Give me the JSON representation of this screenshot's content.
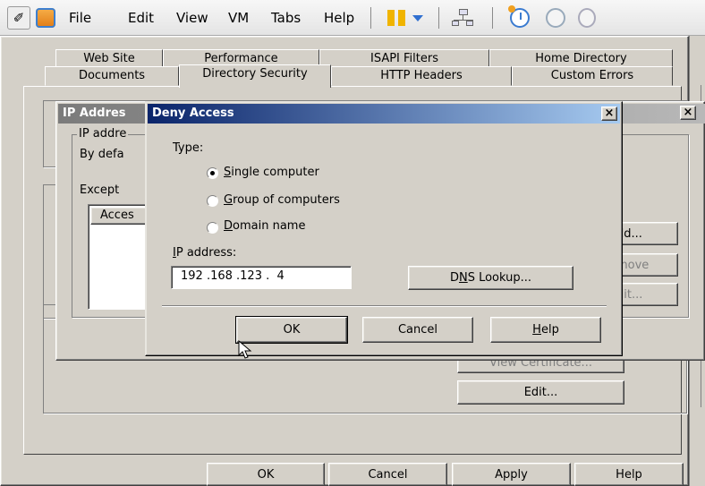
{
  "vm_toolbar": {
    "menus": [
      "File",
      "Edit",
      "View",
      "VM",
      "Tabs",
      "Help"
    ]
  },
  "properties": {
    "tabs_row1": [
      "Web Site",
      "Performance",
      "ISAPI Filters",
      "Home Directory"
    ],
    "tabs_row2": [
      "Documents",
      "Directory Security",
      "HTTP Headers",
      "Custom Errors"
    ],
    "view_certificate": "View Certificate...",
    "edit": "Edit...",
    "ok": "OK",
    "cancel": "Cancel",
    "apply": "Apply",
    "help": "Help"
  },
  "ip_restrictions": {
    "title": "IP Addres",
    "group_label": "IP addre",
    "by_default": "By defa",
    "except": "Except",
    "column": "Acces",
    "add": "dd...",
    "remove": "move",
    "edit": "dit..."
  },
  "deny_dialog": {
    "title": "Deny Access",
    "type_label": "Type:",
    "options": {
      "single": {
        "underline": "S",
        "rest": "ingle computer"
      },
      "group": {
        "underline": "G",
        "rest": "roup of computers"
      },
      "domain": {
        "underline": "D",
        "rest": "omain name"
      }
    },
    "ip_label": {
      "underline": "I",
      "rest": "P address:"
    },
    "ip_value": "192 .168 .123 .  4",
    "dns": {
      "pre": "D",
      "underline": "N",
      "rest": "S Lookup..."
    },
    "ok": "OK",
    "cancel": "Cancel",
    "help": {
      "underline": "H",
      "rest": "elp"
    },
    "close": "×"
  }
}
